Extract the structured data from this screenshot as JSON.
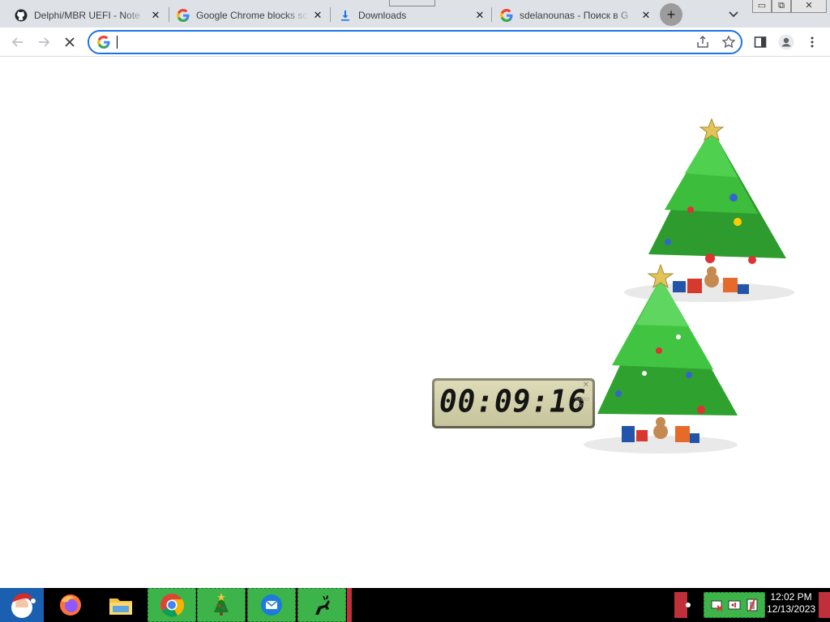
{
  "tabs": [
    {
      "title": "Delphi/MBR UEFI - Note",
      "close": "✕",
      "favicon": "github-icon"
    },
    {
      "title": "Google Chrome blocks so",
      "close": "✕",
      "favicon": "google-icon"
    },
    {
      "title": "Downloads",
      "close": "✕",
      "favicon": "download-icon"
    },
    {
      "title": "sdelanounas - Поиск в G",
      "close": "✕",
      "favicon": "google-icon"
    }
  ],
  "tabstrip": {
    "newtab_label": "+",
    "window_minimize": "▭",
    "window_restore": "⧉",
    "window_close": "✕"
  },
  "omnibox": {
    "value": "",
    "placeholder": ""
  },
  "clock_widget": {
    "time": "00:09:16",
    "close": "✕",
    "side_text": [
      "SHRO",
      "BRT"
    ]
  },
  "taskbar": {
    "apps": [
      "firefox-icon",
      "file-explorer-icon",
      "chrome-icon",
      "christmas-tree-icon",
      "thunderbird-icon",
      "reindeer-icon"
    ],
    "clock_time": "12:02 PM",
    "clock_date": "12/13/2023"
  },
  "colors": {
    "accent": "#1a73e8",
    "tabstrip": "#dee1e6",
    "taskbar_app": "#3cb44a",
    "start": "#1a5fb0"
  }
}
